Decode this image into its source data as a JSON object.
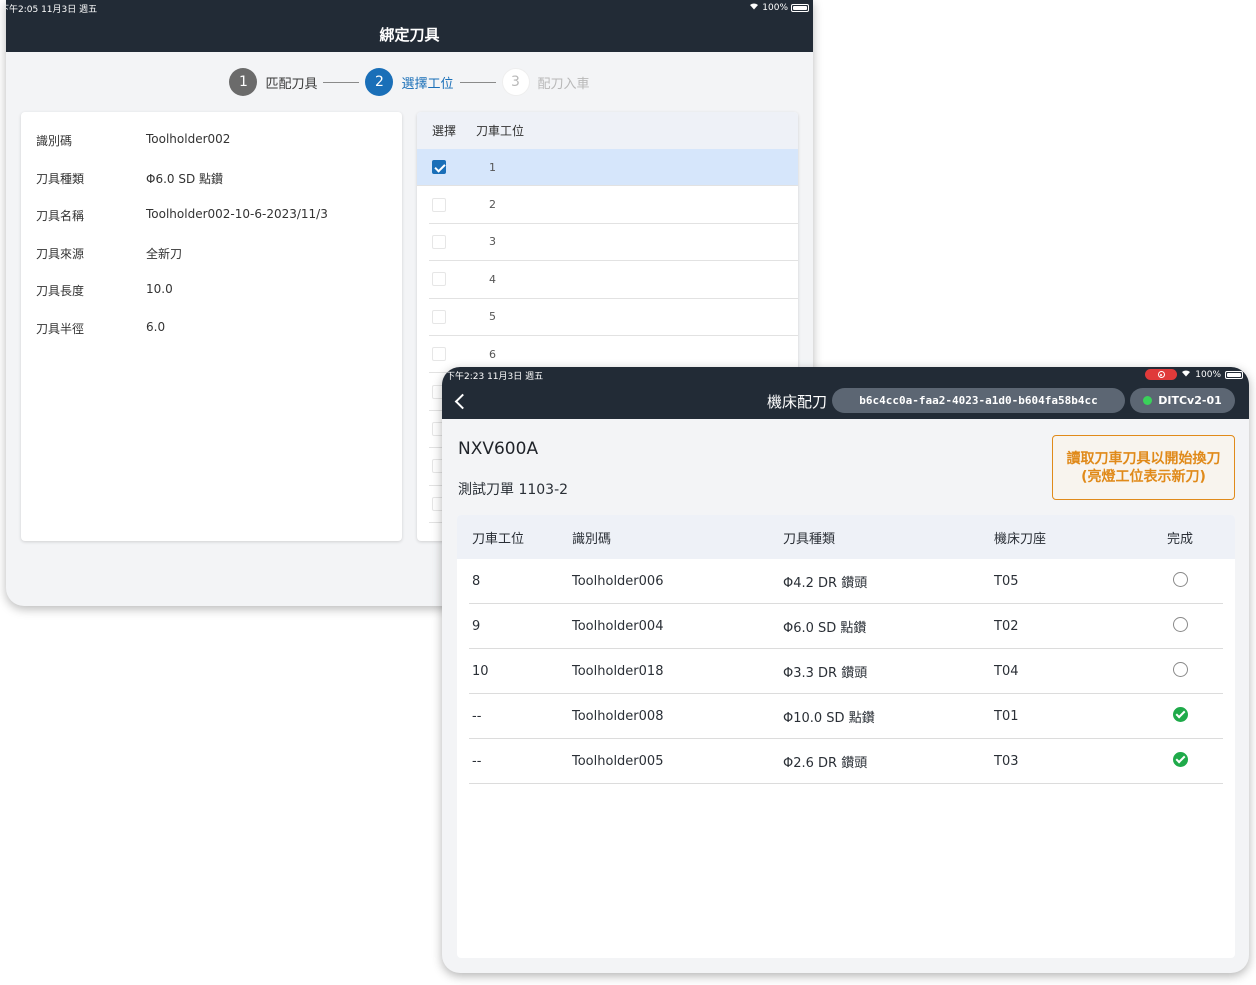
{
  "bind_screen": {
    "status_time": "下午2:05  11月3日 週五",
    "status_battery": "100%",
    "title": "綁定刀具",
    "steps": [
      {
        "num": "1",
        "label": "匹配刀具"
      },
      {
        "num": "2",
        "label": "選擇工位"
      },
      {
        "num": "3",
        "label": "配刀入車"
      }
    ],
    "info": [
      {
        "label": "識別碼",
        "value": "Toolholder002"
      },
      {
        "label": "刀具種類",
        "value": "Φ6.0 SD 點鑽"
      },
      {
        "label": "刀具名稱",
        "value": "Toolholder002-10-6-2023/11/3"
      },
      {
        "label": "刀具來源",
        "value": "全新刀"
      },
      {
        "label": "刀具長度",
        "value": "10.0"
      },
      {
        "label": "刀具半徑",
        "value": "6.0"
      }
    ],
    "slot_table": {
      "headers": [
        "選擇",
        "刀車工位"
      ],
      "rows": [
        "1",
        "2",
        "3",
        "4",
        "5",
        "6"
      ],
      "selected": "1"
    }
  },
  "load_screen": {
    "status_time": "下午2:23  11月3日 週五",
    "status_battery": "100%",
    "title": "機床配刀",
    "session_id": "b6c4cc0a-faa2-4023-a1d0-b604fa58b4cc",
    "device": "DITCv2-01",
    "device_status_color": "#3ad15a",
    "machine": "NXV600A",
    "order": "測試刀單 1103-2",
    "read_button_line1": "讀取刀車刀具以開始換刀",
    "read_button_line2": "(亮燈工位表示新刀)",
    "table": {
      "headers": {
        "slot": "刀車工位",
        "id": "識別碼",
        "type": "刀具種類",
        "seat": "機床刀座",
        "done": "完成"
      },
      "rows": [
        {
          "slot": "8",
          "id": "Toolholder006",
          "type": "Φ4.2 DR 鑽頭",
          "seat": "T05",
          "done": false
        },
        {
          "slot": "9",
          "id": "Toolholder004",
          "type": "Φ6.0 SD 點鑽",
          "seat": "T02",
          "done": false
        },
        {
          "slot": "10",
          "id": "Toolholder018",
          "type": "Φ3.3 DR 鑽頭",
          "seat": "T04",
          "done": false
        },
        {
          "slot": "--",
          "id": "Toolholder008",
          "type": "Φ10.0 SD 點鑽",
          "seat": "T01",
          "done": true
        },
        {
          "slot": "--",
          "id": "Toolholder005",
          "type": "Φ2.6 DR 鑽頭",
          "seat": "T03",
          "done": true
        }
      ]
    }
  }
}
